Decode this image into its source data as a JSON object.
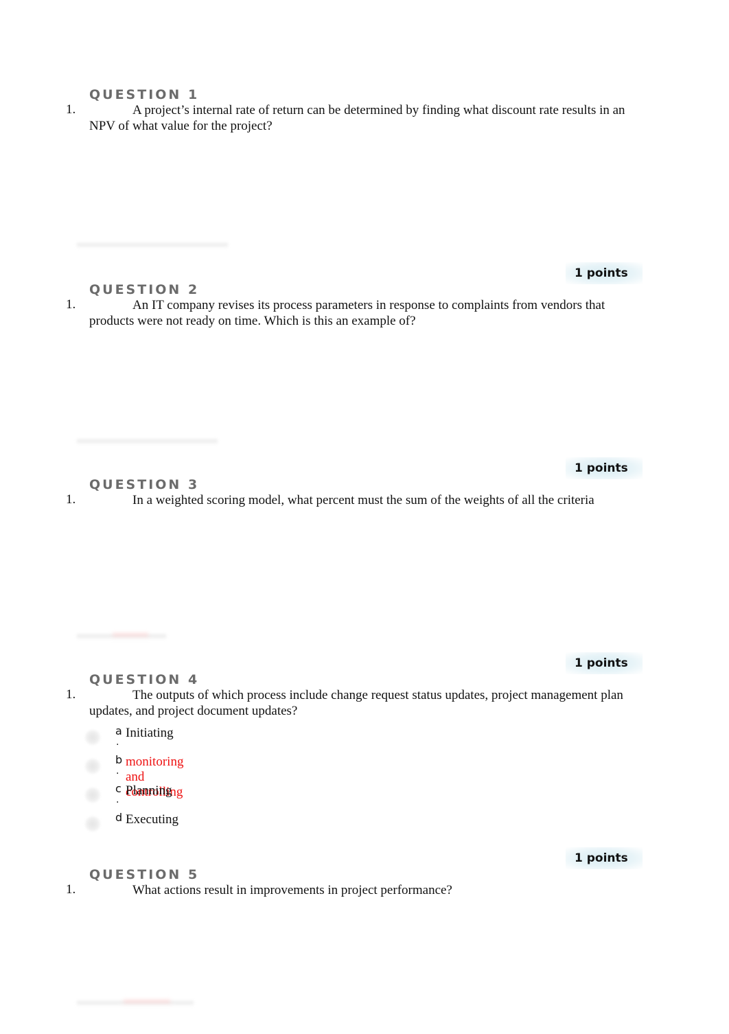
{
  "questions": [
    {
      "title": "QUESTION 1",
      "number": "1.",
      "text": "A project’s internal rate of return can be determined by finding what discount rate results in an NPV of what value for the project?",
      "points": "1 points"
    },
    {
      "title": "QUESTION 2",
      "number": "1.",
      "text": "An IT company revises its process parameters in response to complaints from vendors that products were not ready on time. Which is this an example of?",
      "points": "1 points"
    },
    {
      "title": "QUESTION 3",
      "number": "1.",
      "text": "In a weighted scoring model, what percent must the sum of the weights of all the criteria",
      "points": "1 points"
    },
    {
      "title": "QUESTION 4",
      "number": "1.",
      "text": "The outputs of which process include change request status updates, project management plan updates, and project document updates?",
      "options": [
        {
          "letter": "a",
          "dot": ".",
          "text": "Initiating",
          "selected": false
        },
        {
          "letter": "b",
          "dot": ".",
          "text": "monitoring and controlling",
          "selected": true
        },
        {
          "letter": "c",
          "dot": ".",
          "text": "Planning",
          "selected": false
        },
        {
          "letter": "d",
          "dot": "",
          "text": "Executing",
          "selected": false
        }
      ],
      "points": "1 points"
    },
    {
      "title": "QUESTION 5",
      "number": "1.",
      "text": "What actions result in improvements in project performance?"
    }
  ],
  "colors": {
    "heading": "#6b6b6b",
    "selected_answer": "#ee1111",
    "points_badge_bg": "#d8ecf2"
  }
}
